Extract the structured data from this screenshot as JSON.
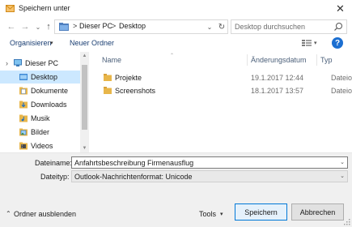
{
  "window": {
    "title": "Speichern unter",
    "close_glyph": "✕",
    "accent_color": "#0078d7"
  },
  "nav": {
    "back_glyph": "←",
    "forward_glyph": "→",
    "dropdown_glyph": "⌄",
    "up_glyph": "↑",
    "breadcrumb_separator": ">",
    "breadcrumbs": [
      "Dieser PC",
      "Desktop"
    ],
    "address_dropdown_glyph": "⌄",
    "refresh_glyph": "↻",
    "search_placeholder": "Desktop durchsuchen"
  },
  "toolbar": {
    "organize_label": "Organisieren",
    "organize_chevron": "▾",
    "new_folder_label": "Neuer Ordner",
    "view_chevron": "▾",
    "help_label": "?"
  },
  "sidebar": {
    "items": [
      {
        "label": "Dieser PC",
        "icon": "computer-icon",
        "selected": false
      },
      {
        "label": "Desktop",
        "icon": "desktop-folder-icon",
        "selected": true
      },
      {
        "label": "Dokumente",
        "icon": "documents-icon",
        "selected": false
      },
      {
        "label": "Downloads",
        "icon": "downloads-icon",
        "selected": false
      },
      {
        "label": "Musik",
        "icon": "music-icon",
        "selected": false
      },
      {
        "label": "Bilder",
        "icon": "pictures-icon",
        "selected": false
      },
      {
        "label": "Videos",
        "icon": "videos-icon",
        "selected": false
      }
    ],
    "expand_glyph": "›",
    "scroll_up": "▲",
    "scroll_down": "▼",
    "selected_color": "#cce8ff"
  },
  "file_list": {
    "sort_indicator": "⌃",
    "columns": [
      "Name",
      "Änderungsdatum",
      "Typ"
    ],
    "rows": [
      {
        "name": "Projekte",
        "date": "19.1.2017 12:44",
        "type": "Dateiordner"
      },
      {
        "name": "Screenshots",
        "date": "18.1.2017 13:57",
        "type": "Dateiordner"
      }
    ]
  },
  "form": {
    "filename_label": "Dateiname:",
    "filename_value": "Anfahrtsbeschreibung Firmenausflug",
    "filename_dropdown": "⌄",
    "filetype_label": "Dateityp:",
    "filetype_value": "Outlook-Nachrichtenformat: Unicode",
    "filetype_dropdown": "⌄"
  },
  "footer": {
    "hide_folders_chevron": "⌃",
    "hide_folders_label": "Ordner ausblenden",
    "tools_label": "Tools",
    "tools_chevron": "▾",
    "save_label": "Speichern",
    "cancel_label": "Abbrechen"
  }
}
